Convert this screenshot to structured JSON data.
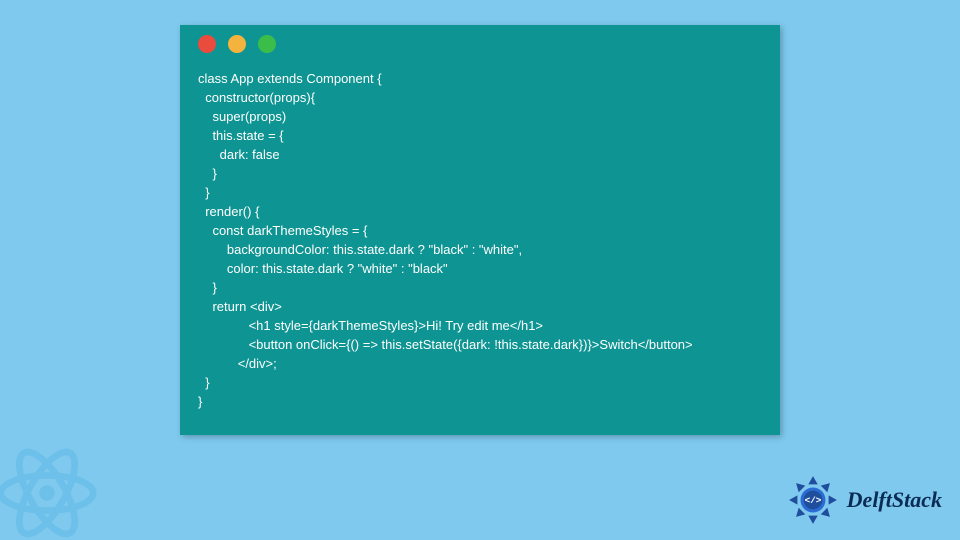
{
  "code": {
    "lines": [
      "class App extends Component {",
      "  constructor(props){",
      "    super(props)",
      "    this.state = {",
      "      dark: false",
      "    }",
      "  }",
      "  render() {",
      "    const darkThemeStyles = {",
      "        backgroundColor: this.state.dark ? \"black\" : \"white\",",
      "        color: this.state.dark ? \"white\" : \"black\"",
      "    }",
      "    return <div>",
      "              <h1 style={darkThemeStyles}>Hi! Try edit me</h1>",
      "              <button onClick={() => this.setState({dark: !this.state.dark})}>Switch</button>",
      "           </div>;",
      "  }",
      "}"
    ]
  },
  "brand": {
    "name": "DelftStack"
  },
  "traffic_lights": {
    "red": "#e94b3c",
    "yellow": "#f3b33d",
    "green": "#3bbd4a"
  }
}
